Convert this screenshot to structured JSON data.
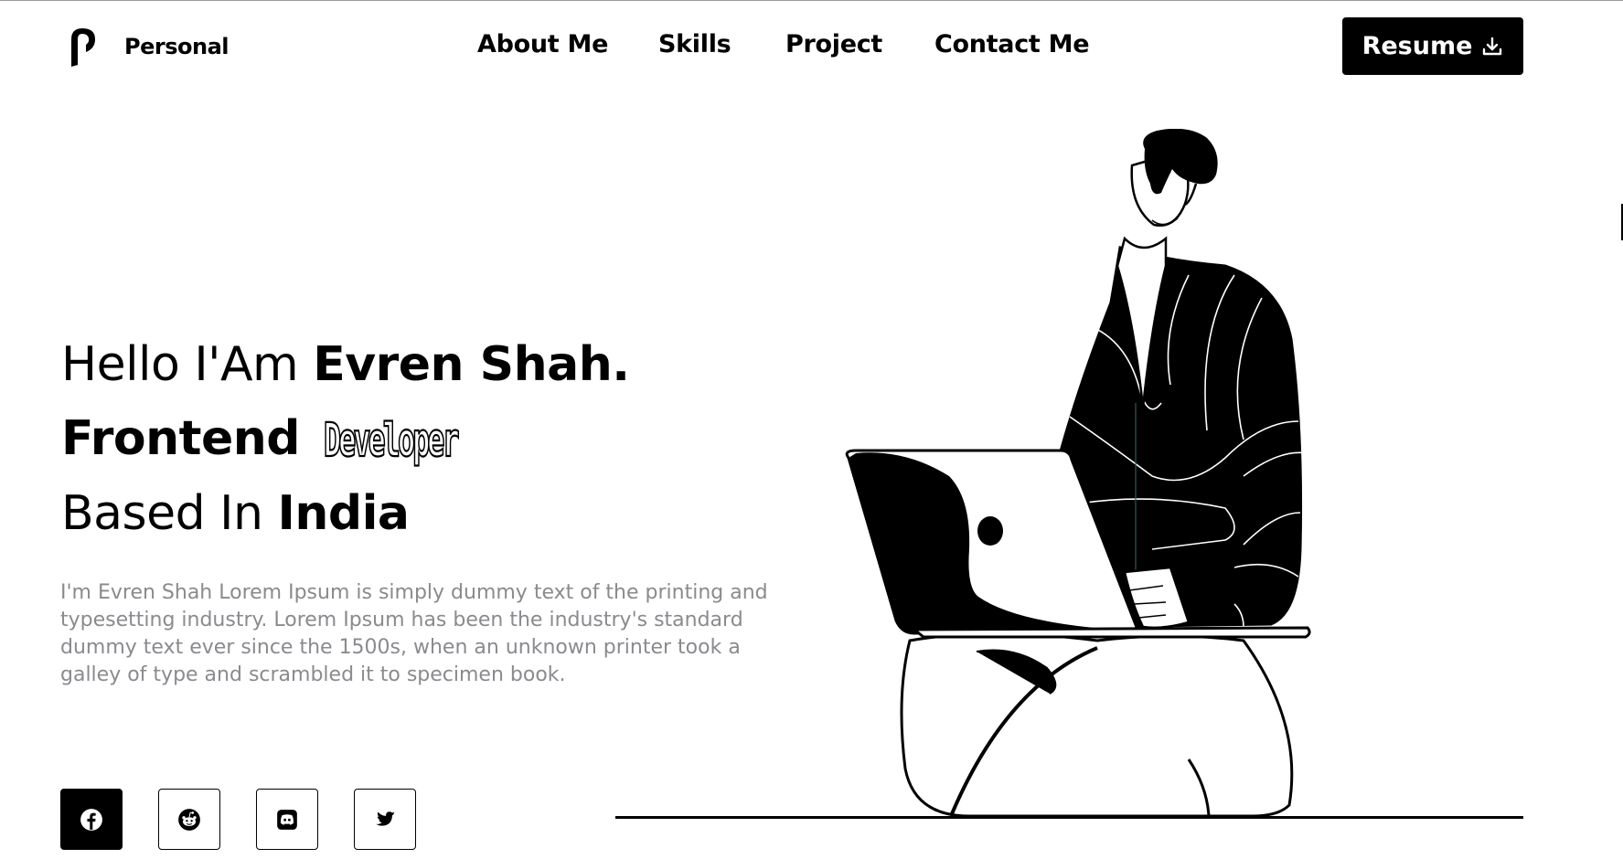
{
  "header": {
    "logo_text": "Personal",
    "nav": [
      "About Me",
      "Skills",
      "Project",
      "Contact Me"
    ],
    "resume_label": "Resume"
  },
  "hero": {
    "line1_prefix": "Hello I'Am ",
    "line1_name": "Evren Shah.",
    "line2_bold": "Frontend ",
    "line2_outline": "Developer",
    "line3_prefix": "Based In ",
    "line3_bold": "India",
    "description": "I'm Evren Shah Lorem Ipsum is simply dummy text of the printing and typesetting industry. Lorem Ipsum has been the industry's standard dummy text ever since the 1500s, when an unknown printer took a galley of type and scrambled it to specimen book."
  },
  "social": [
    {
      "icon": "facebook-icon"
    },
    {
      "icon": "reddit-icon"
    },
    {
      "icon": "discord-icon"
    },
    {
      "icon": "twitter-icon"
    }
  ],
  "colors": {
    "accent": "#000000",
    "background": "#ffffff",
    "muted_text": "#8a8a8f"
  }
}
